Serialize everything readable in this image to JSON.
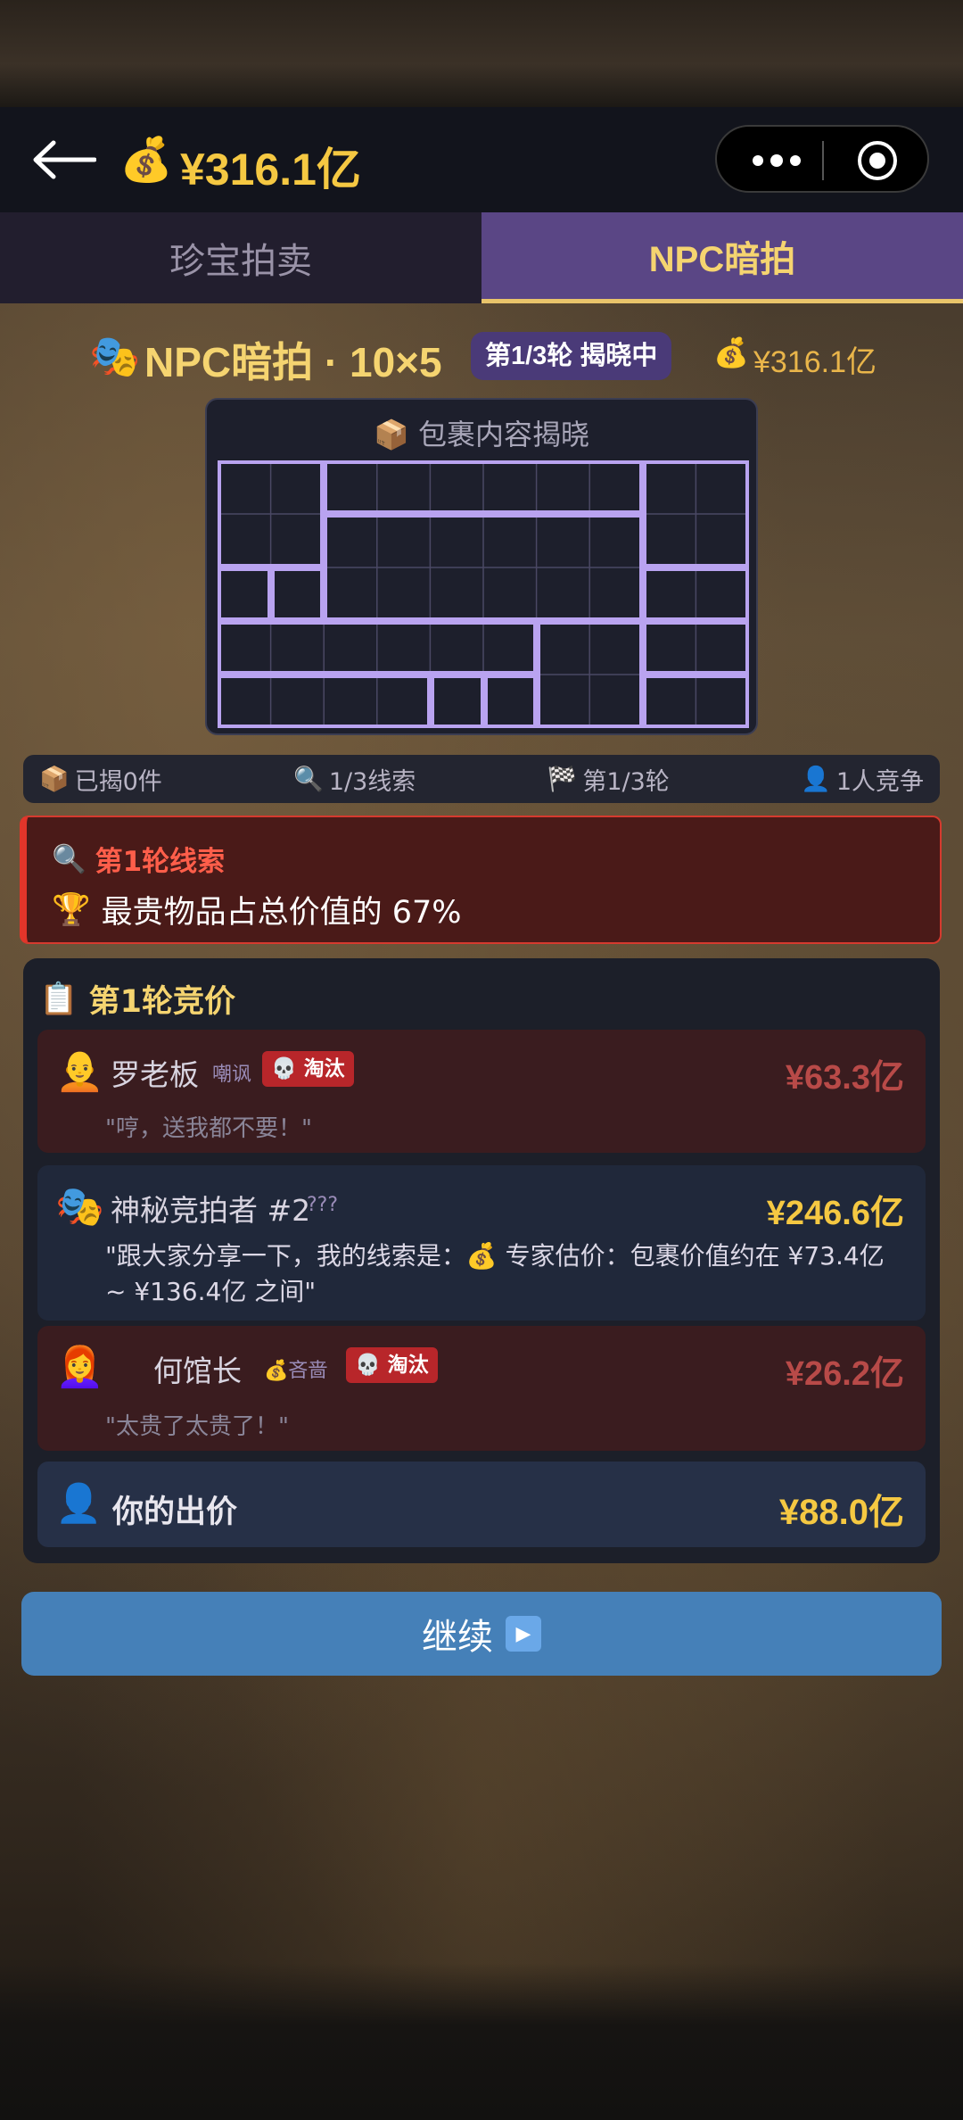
{
  "header": {
    "balance": "¥316.1亿"
  },
  "tabs": [
    {
      "label": "珍宝拍卖",
      "active": false
    },
    {
      "label": "NPC暗拍",
      "active": true
    }
  ],
  "game": {
    "title": "NPC暗拍 · 10×5",
    "round_badge": "第1/3轮 揭晓中",
    "balance": "¥316.1亿"
  },
  "reveal": {
    "header": "包裹内容揭晓"
  },
  "stats": {
    "revealed": "已揭0件",
    "clues": "1/3线索",
    "round": "第1/3轮",
    "competitors": "1人竞争"
  },
  "clue": {
    "title": "第1轮线索",
    "text": "最贵物品占总价值的 67%"
  },
  "bidding": {
    "title": "第1轮竞价",
    "bidders": [
      {
        "name": "罗老板",
        "tag": "嘲讽",
        "badge": "淘汰",
        "amount": "¥63.3亿",
        "quote": "\"哼，送我都不要！\""
      },
      {
        "name": "神秘竞拍者 #2",
        "tag": "???",
        "badge": "",
        "amount": "¥246.6亿",
        "quote": "\"跟大家分享一下，我的线索是：💰 专家估价：包裹价值约在 ¥73.4亿 ~ ¥136.4亿 之间\""
      },
      {
        "name": "何馆长",
        "tag": "吝啬",
        "badge": "淘汰",
        "amount": "¥26.2亿",
        "quote": "\"太贵了太贵了！\""
      }
    ],
    "your_bid_label": "你的出价",
    "your_bid_amount": "¥88.0亿"
  },
  "continue_label": "继续",
  "colors": {
    "gold": "#f5c842",
    "purple_active_tab": "#5a4685",
    "grid_line": "#b9a3f0",
    "eliminated_red": "#b8262a",
    "continue_blue": "#4580b8"
  }
}
